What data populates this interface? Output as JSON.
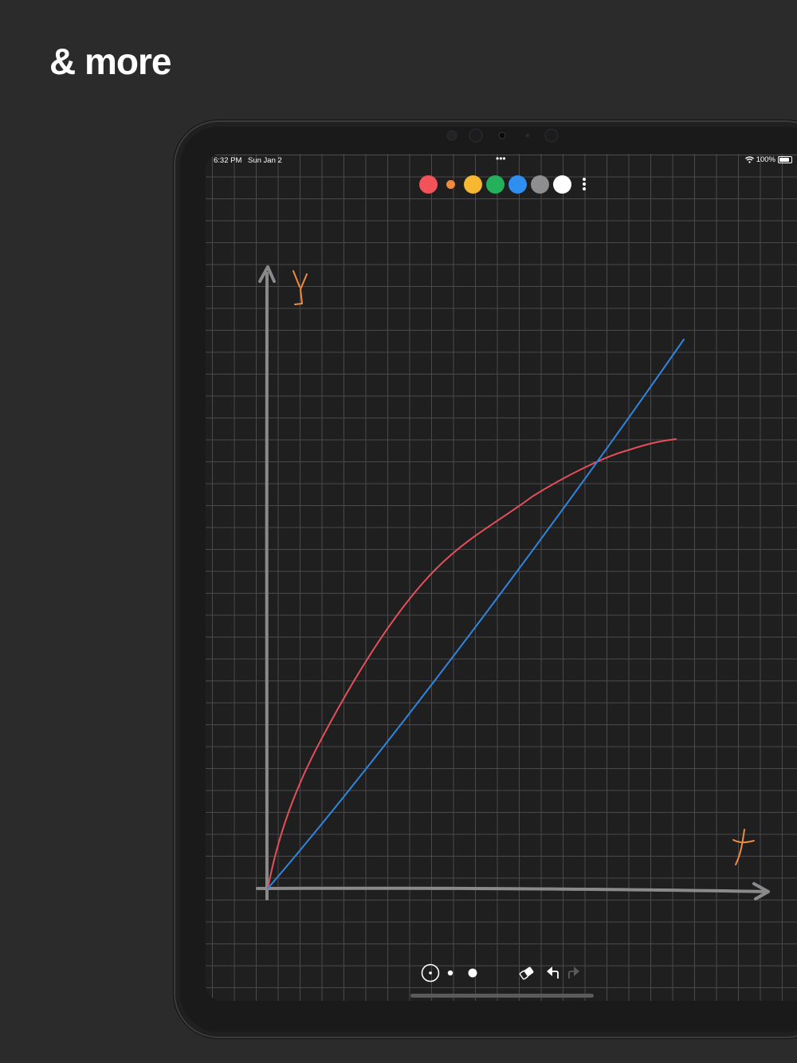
{
  "promo": {
    "headline": "& more"
  },
  "status_bar": {
    "time": "6:32 PM",
    "date": "Sun Jan 2",
    "multitask_dots": "•••",
    "battery": "100%",
    "battery_level": 1.0
  },
  "palette": {
    "colors": [
      {
        "name": "red",
        "hex": "#f4525a",
        "size": "large"
      },
      {
        "name": "orange",
        "hex": "#f08a3c",
        "size": "small"
      },
      {
        "name": "yellow",
        "hex": "#f7b731",
        "size": "large"
      },
      {
        "name": "green",
        "hex": "#23b25b",
        "size": "large"
      },
      {
        "name": "blue",
        "hex": "#2f8ff0",
        "size": "large"
      },
      {
        "name": "gray",
        "hex": "#8e8e90",
        "size": "large"
      },
      {
        "name": "white",
        "hex": "#ffffff",
        "size": "large",
        "selected": true
      }
    ],
    "more_icon": "vertical-ellipsis-icon"
  },
  "canvas": {
    "background": "#1f1f20",
    "grid_color": "#4a4a4c",
    "axis_color": "#8a8a8c",
    "handwritten_labels": [
      {
        "text": "Y",
        "color": "#f08a3c"
      },
      {
        "text": "X",
        "color": "#f08a3c"
      }
    ],
    "strokes": [
      {
        "name": "red-curve",
        "color": "#e4505a"
      },
      {
        "name": "blue-line",
        "color": "#2f86e0"
      }
    ]
  },
  "toolbar": {
    "tools": [
      {
        "name": "lasso-select-icon"
      },
      {
        "name": "small-brush-icon"
      },
      {
        "name": "large-brush-icon"
      },
      {
        "name": "eraser-icon"
      },
      {
        "name": "undo-icon"
      },
      {
        "name": "redo-icon",
        "enabled": false
      }
    ]
  }
}
